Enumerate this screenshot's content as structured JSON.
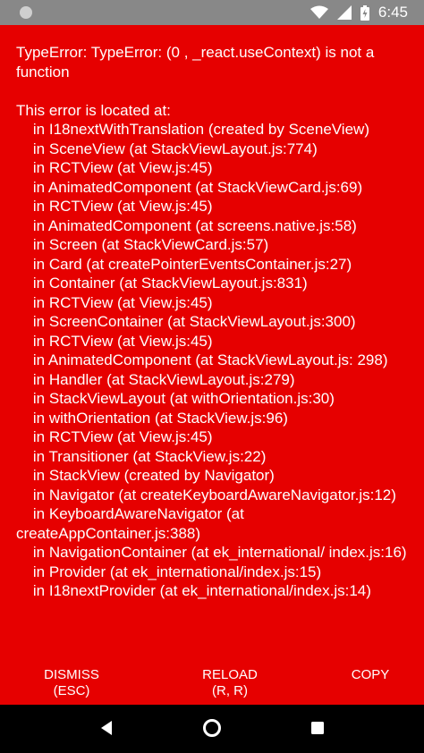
{
  "status_bar": {
    "time": "6:45"
  },
  "error": {
    "title": "TypeError: TypeError: (0 , _react.useContext) is not a function",
    "located_header": "This error is located at:",
    "stack": [
      "    in I18nextWithTranslation (created by SceneView)",
      "    in SceneView (at StackViewLayout.js:774)",
      "    in RCTView (at View.js:45)",
      "    in AnimatedComponent (at StackViewCard.js:69)",
      "    in RCTView (at View.js:45)",
      "    in AnimatedComponent (at screens.native.js:58)",
      "    in Screen (at StackViewCard.js:57)",
      "    in Card (at createPointerEventsContainer.js:27)",
      "    in Container (at StackViewLayout.js:831)",
      "    in RCTView (at View.js:45)",
      "    in ScreenContainer (at StackViewLayout.js:300)",
      "    in RCTView (at View.js:45)",
      "    in AnimatedComponent (at StackViewLayout.js: 298)",
      "    in Handler (at StackViewLayout.js:279)",
      "    in StackViewLayout (at withOrientation.js:30)",
      "    in withOrientation (at StackView.js:96)",
      "    in RCTView (at View.js:45)",
      "    in Transitioner (at StackView.js:22)",
      "    in StackView (created by Navigator)",
      "    in Navigator (at createKeyboardAwareNavigator.js:12)",
      "    in KeyboardAwareNavigator (at createAppContainer.js:388)",
      "    in NavigationContainer (at ek_international/ index.js:16)",
      "    in Provider (at ek_international/index.js:15)",
      "    in I18nextProvider (at ek_international/index.js:14)"
    ]
  },
  "actions": {
    "dismiss_label": "DISMISS\n(ESC)",
    "reload_label": "RELOAD\n(R, R)",
    "copy_label": "COPY"
  },
  "icons": {
    "wifi": "wifi-icon",
    "signal": "signal-icon",
    "battery": "battery-icon",
    "back": "back-icon",
    "home": "home-icon",
    "recents": "recents-icon"
  },
  "colors": {
    "error_background": "#e60000",
    "status_bar": "#888888",
    "nav_bar": "#000000",
    "text": "#ffffff"
  }
}
